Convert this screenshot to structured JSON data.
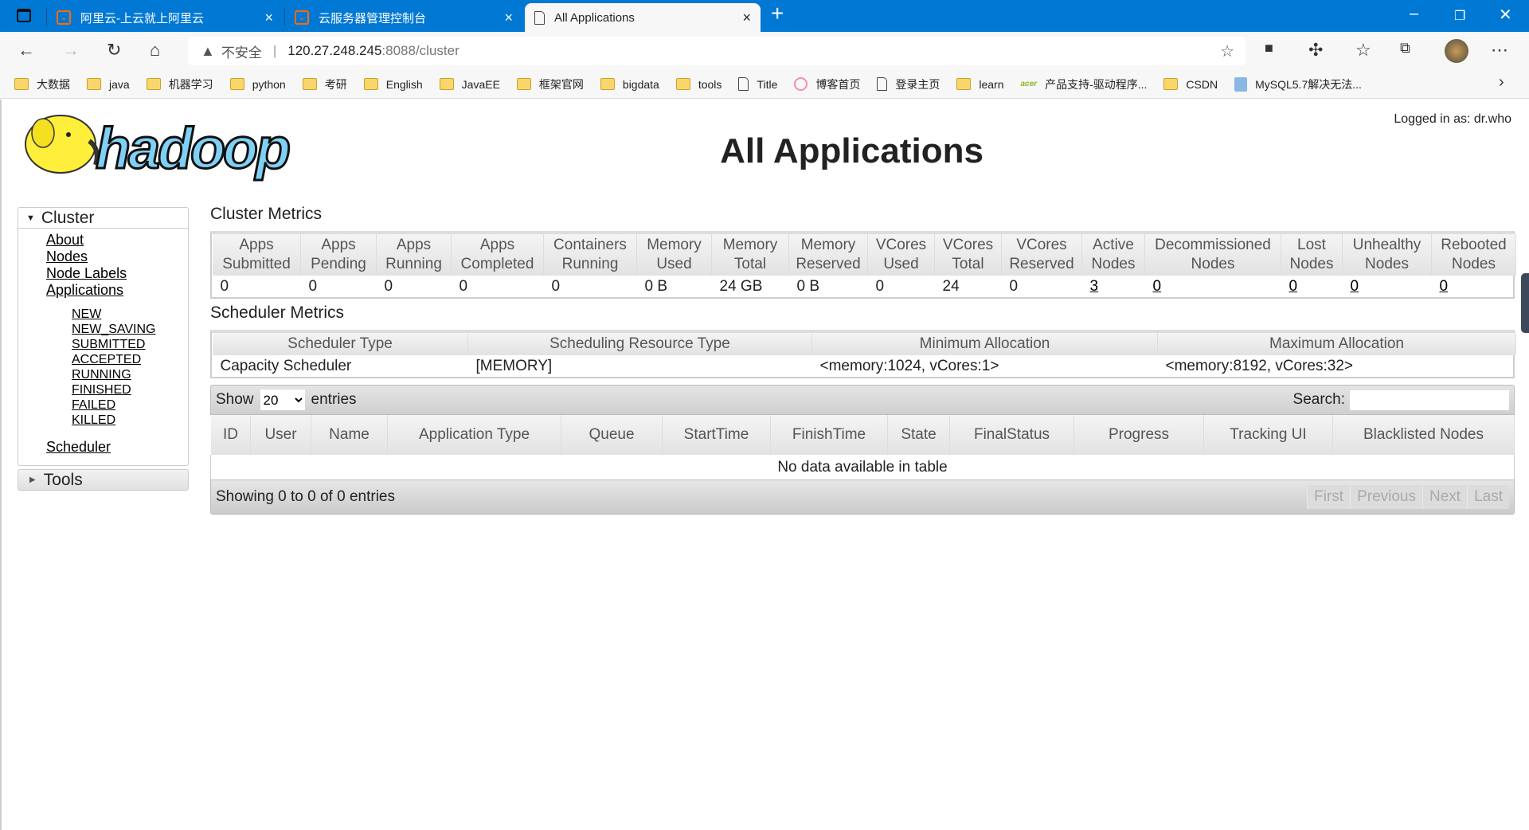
{
  "browser": {
    "tabs": [
      {
        "label": "阿里云-上云就上阿里云",
        "icon": "aliyun-icon"
      },
      {
        "label": "云服务器管理控制台",
        "icon": "aliyun-icon"
      },
      {
        "label": "All Applications",
        "icon": "page-icon",
        "active": true
      }
    ],
    "security_label": "不安全",
    "url_host": "120.27.248.245",
    "url_rest": ":8088/cluster",
    "bookmarks": [
      {
        "label": "大数据",
        "icon": "folder"
      },
      {
        "label": "java",
        "icon": "folder"
      },
      {
        "label": "机器学习",
        "icon": "folder"
      },
      {
        "label": "python",
        "icon": "folder"
      },
      {
        "label": "考研",
        "icon": "folder"
      },
      {
        "label": "English",
        "icon": "folder"
      },
      {
        "label": "JavaEE",
        "icon": "folder"
      },
      {
        "label": "框架官网",
        "icon": "folder"
      },
      {
        "label": "bigdata",
        "icon": "folder"
      },
      {
        "label": "tools",
        "icon": "folder"
      },
      {
        "label": "Title",
        "icon": "page"
      },
      {
        "label": "博客首页",
        "icon": "csdn-blog"
      },
      {
        "label": "登录主页",
        "icon": "page"
      },
      {
        "label": "learn",
        "icon": "folder"
      },
      {
        "label": "产品支持-驱动程序...",
        "icon": "acer"
      },
      {
        "label": "CSDN",
        "icon": "folder"
      },
      {
        "label": "MySQL5.7解决无法...",
        "icon": "mysql"
      }
    ]
  },
  "header": {
    "logo_text": "hadoop",
    "title": "All Applications",
    "logged_in": "Logged in as: dr.who"
  },
  "sidebar": {
    "cluster_label": "Cluster",
    "links": [
      "About",
      "Nodes",
      "Node Labels",
      "Applications"
    ],
    "app_states": [
      "NEW",
      "NEW_SAVING",
      "SUBMITTED",
      "ACCEPTED",
      "RUNNING",
      "FINISHED",
      "FAILED",
      "KILLED"
    ],
    "scheduler": "Scheduler",
    "tools_label": "Tools"
  },
  "cluster_metrics": {
    "title": "Cluster Metrics",
    "columns": [
      [
        "Apps",
        "Submitted"
      ],
      [
        "Apps",
        "Pending"
      ],
      [
        "Apps",
        "Running"
      ],
      [
        "Apps",
        "Completed"
      ],
      [
        "Containers",
        "Running"
      ],
      [
        "Memory",
        "Used"
      ],
      [
        "Memory",
        "Total"
      ],
      [
        "Memory",
        "Reserved"
      ],
      [
        "VCores",
        "Used"
      ],
      [
        "VCores",
        "Total"
      ],
      [
        "VCores",
        "Reserved"
      ],
      [
        "Active",
        "Nodes"
      ],
      [
        "Decommissioned",
        "Nodes"
      ],
      [
        "Lost",
        "Nodes"
      ],
      [
        "Unhealthy",
        "Nodes"
      ],
      [
        "Rebooted",
        "Nodes"
      ]
    ],
    "values": [
      "0",
      "0",
      "0",
      "0",
      "0",
      "0 B",
      "24 GB",
      "0 B",
      "0",
      "24",
      "0",
      "3",
      "0",
      "0",
      "0",
      "0"
    ],
    "linked": [
      11,
      12,
      13,
      14,
      15
    ]
  },
  "scheduler_metrics": {
    "title": "Scheduler Metrics",
    "columns": [
      "Scheduler Type",
      "Scheduling Resource Type",
      "Minimum Allocation",
      "Maximum Allocation"
    ],
    "values": [
      "Capacity Scheduler",
      "[MEMORY]",
      "<memory:1024, vCores:1>",
      "<memory:8192, vCores:32>"
    ]
  },
  "apps_table": {
    "show_label": "Show",
    "entries_value": "20",
    "entries_label": "entries",
    "search_label": "Search:",
    "search_value": "",
    "columns": [
      "ID",
      "User",
      "Name",
      "Application Type",
      "Queue",
      "StartTime",
      "FinishTime",
      "State",
      "FinalStatus",
      "Progress",
      "Tracking UI",
      "Blacklisted Nodes"
    ],
    "empty": "No data available in table",
    "info": "Showing 0 to 0 of 0 entries",
    "pager": [
      "First",
      "Previous",
      "Next",
      "Last"
    ]
  }
}
